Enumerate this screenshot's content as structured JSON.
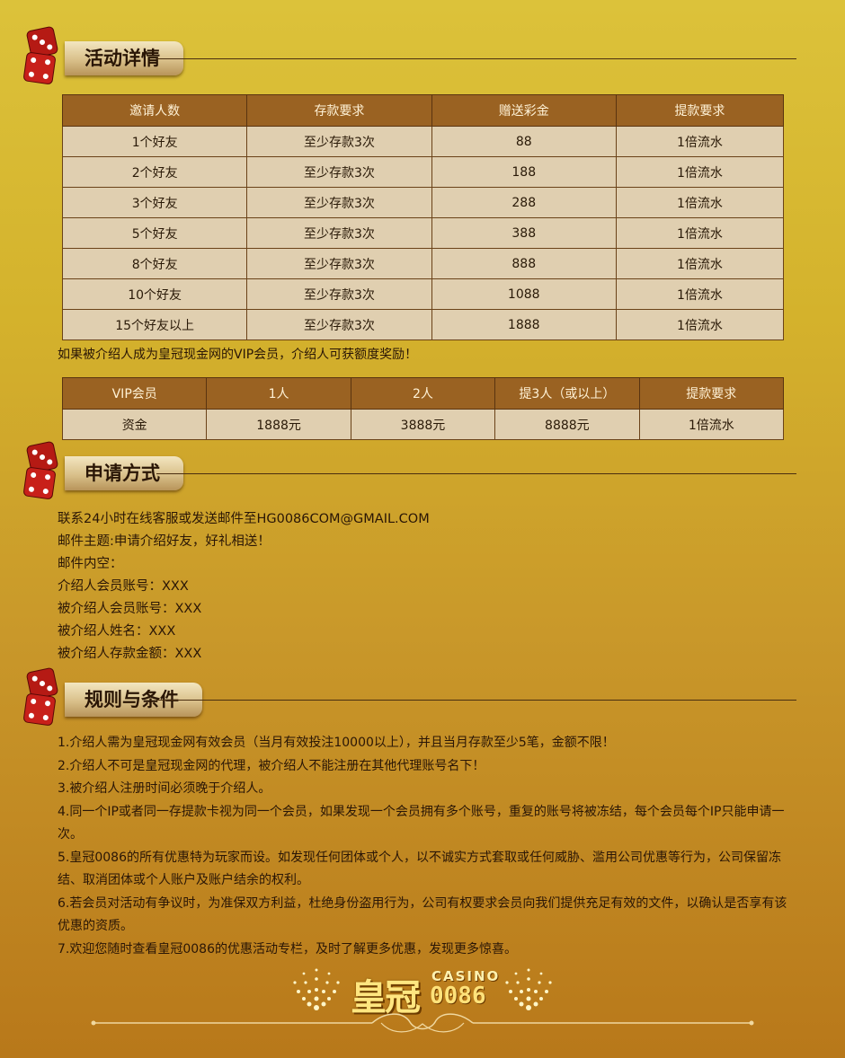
{
  "section1": {
    "title": "活动详情"
  },
  "table1": {
    "headers": [
      "邀请人数",
      "存款要求",
      "赠送彩金",
      "提款要求"
    ],
    "rows": [
      [
        "1个好友",
        "至少存款3次",
        "88",
        "1倍流水"
      ],
      [
        "2个好友",
        "至少存款3次",
        "188",
        "1倍流水"
      ],
      [
        "3个好友",
        "至少存款3次",
        "288",
        "1倍流水"
      ],
      [
        "5个好友",
        "至少存款3次",
        "388",
        "1倍流水"
      ],
      [
        "8个好友",
        "至少存款3次",
        "888",
        "1倍流水"
      ],
      [
        "10个好友",
        "至少存款3次",
        "1088",
        "1倍流水"
      ],
      [
        "15个好友以上",
        "至少存款3次",
        "1888",
        "1倍流水"
      ]
    ]
  },
  "vip_note": "如果被介绍人成为皇冠现金网的VIP会员，介绍人可获额度奖励！",
  "table2": {
    "headers": [
      "VIP会员",
      "1人",
      "2人",
      "提3人（或以上）",
      "提款要求"
    ],
    "rows": [
      [
        "资金",
        "1888元",
        "3888元",
        "8888元",
        "1倍流水"
      ]
    ]
  },
  "section2": {
    "title": "申请方式",
    "lines": [
      "联系24小时在线客服或发送邮件至HG0086COM@GMAIL.COM",
      "邮件主题:申请介绍好友，好礼相送！",
      "邮件内空：",
      "介绍人会员账号：XXX",
      "被介绍人会员账号：XXX",
      "被介绍人姓名：XXX",
      "被介绍人存款金额：XXX"
    ]
  },
  "section3": {
    "title": "规则与条件",
    "rules": [
      "1.介绍人需为皇冠现金网有效会员（当月有效投注10000以上），并且当月存款至少5笔，金额不限！",
      "2.介绍人不可是皇冠现金网的代理，被介绍人不能注册在其他代理账号名下！",
      "3.被介绍人注册时间必须晚于介绍人。",
      "4.同一个IP或者同一存提款卡视为同一个会员，如果发现一个会员拥有多个账号，重复的账号将被冻结，每个会员每个IP只能申请一次。",
      "5.皇冠0086的所有优惠特为玩家而设。如发现任何团体或个人，以不诚实方式套取或任何威胁、滥用公司优惠等行为，公司保留冻结、取消团体或个人账户及账户结余的权利。",
      "6.若会员对活动有争议时，为准保双方利益，杜绝身份盗用行为，公司有权要求会员向我们提供充足有效的文件，以确认是否享有该优惠的资质。",
      "7.欢迎您随时查看皇冠0086的优惠活动专栏，及时了解更多优惠，发现更多惊喜。"
    ]
  },
  "footer": {
    "logo_main": "皇冠",
    "logo_casino": "CASINO",
    "logo_number": "0086"
  }
}
